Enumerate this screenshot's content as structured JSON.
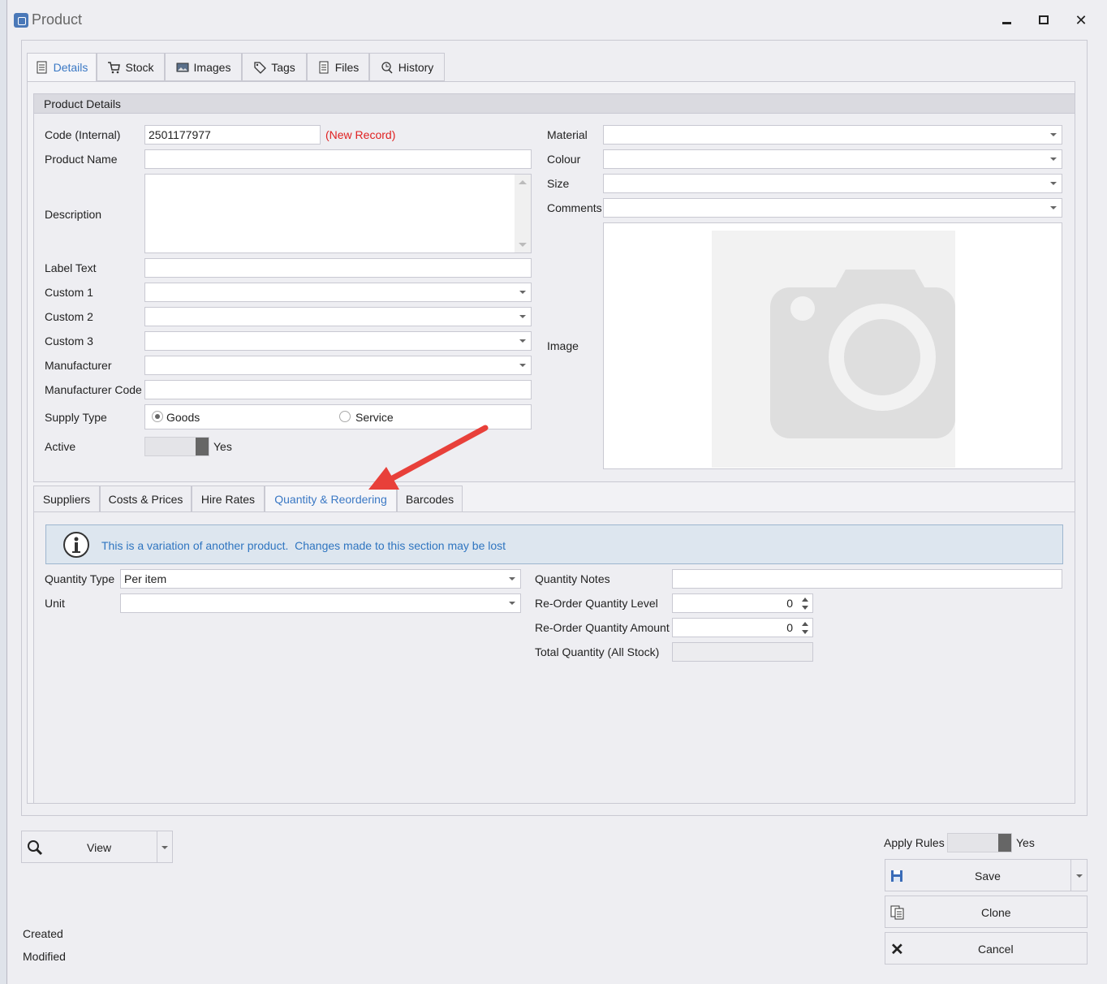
{
  "window": {
    "title": "Product"
  },
  "tabs": [
    {
      "label": "Details",
      "icon": "document-icon",
      "active": true
    },
    {
      "label": "Stock",
      "icon": "cart-icon"
    },
    {
      "label": "Images",
      "icon": "picture-icon"
    },
    {
      "label": "Tags",
      "icon": "tag-icon"
    },
    {
      "label": "Files",
      "icon": "files-icon"
    },
    {
      "label": "History",
      "icon": "history-icon"
    }
  ],
  "details": {
    "group_title": "Product Details",
    "code_label": "Code (Internal)",
    "code_value": "2501177977",
    "new_record": "(New Record)",
    "product_name_label": "Product Name",
    "description_label": "Description",
    "label_text_label": "Label Text",
    "custom1_label": "Custom 1",
    "custom2_label": "Custom 2",
    "custom3_label": "Custom 3",
    "manufacturer_label": "Manufacturer",
    "manufacturer_code_label": "Manufacturer Code",
    "supply_type_label": "Supply Type",
    "supply_goods": "Goods",
    "supply_service": "Service",
    "supply_selected": "Goods",
    "active_label": "Active",
    "active_value": "Yes",
    "material_label": "Material",
    "colour_label": "Colour",
    "size_label": "Size",
    "comments_label": "Comments",
    "image_label": "Image"
  },
  "subtabs": [
    {
      "label": "Suppliers"
    },
    {
      "label": "Costs & Prices"
    },
    {
      "label": "Hire Rates"
    },
    {
      "label": "Quantity & Reordering",
      "active": true
    },
    {
      "label": "Barcodes"
    }
  ],
  "quantity": {
    "info_text": "This is a variation of another product.  Changes made to this section may be lost",
    "quantity_type_label": "Quantity Type",
    "quantity_type_value": "Per item",
    "unit_label": "Unit",
    "quantity_notes_label": "Quantity Notes",
    "reorder_level_label": "Re-Order Quantity Level",
    "reorder_level_value": "0",
    "reorder_amount_label": "Re-Order Quantity Amount",
    "reorder_amount_value": "0",
    "total_quantity_label": "Total Quantity (All Stock)"
  },
  "footer": {
    "view_label": "View",
    "apply_rules_label": "Apply Rules",
    "apply_rules_value": "Yes",
    "save_label": "Save",
    "clone_label": "Clone",
    "cancel_label": "Cancel",
    "created_label": "Created",
    "modified_label": "Modified"
  },
  "colors": {
    "accent": "#3a78c4",
    "new_record": "#e02020",
    "arrow": "#e8403a",
    "info_bg": "#dde6ef"
  }
}
